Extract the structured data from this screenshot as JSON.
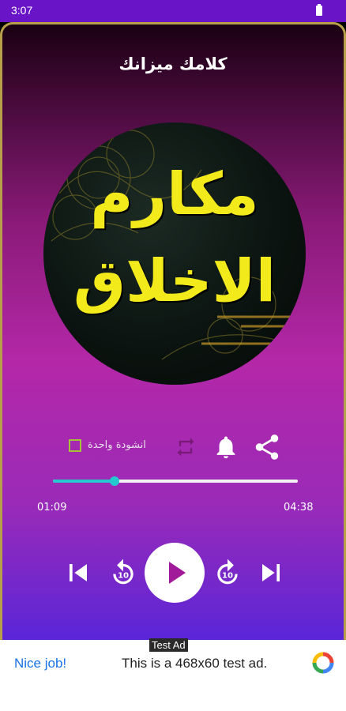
{
  "status_bar": {
    "time": "3:07",
    "battery_icon": "battery-icon"
  },
  "header": {
    "title": "كلامك ميزانك"
  },
  "artwork": {
    "line1": "مكارم",
    "line2": "الاخلاق"
  },
  "options": {
    "single_label": "انشودة واحدة",
    "single_checked": false,
    "icons": [
      "repeat-icon",
      "bell-icon",
      "share-icon"
    ]
  },
  "seek": {
    "current": "01:09",
    "total": "04:38",
    "progress": 0.25
  },
  "controls": {
    "icons": [
      "skip-previous-icon",
      "rewind-10-icon",
      "play-icon",
      "forward-10-icon",
      "skip-next-icon"
    ],
    "skip_seconds": "10"
  },
  "ad": {
    "tag": "Test Ad",
    "left_text": "Nice job!",
    "text": "This is a 468x60 test ad."
  },
  "colors": {
    "status_bar": "#6a14c8",
    "accent": "#26c8cf",
    "art_text": "#f2ea1a",
    "frame_border": "#b8a04a"
  }
}
